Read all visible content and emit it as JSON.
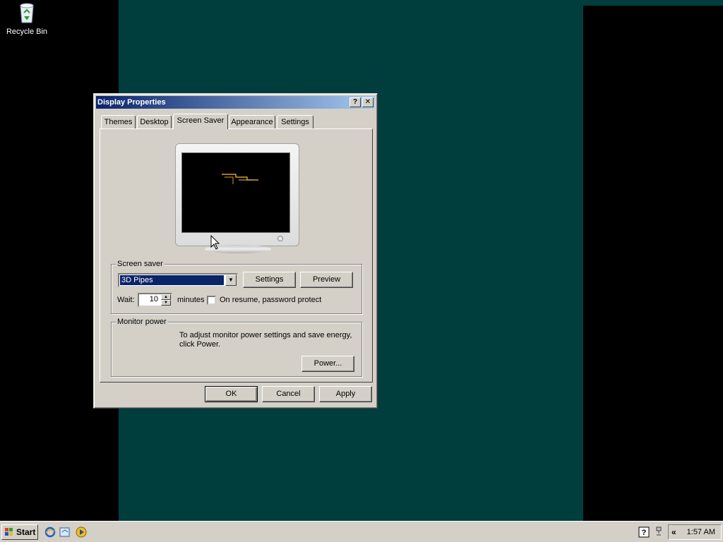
{
  "desktop": {
    "background_color": "#003d3d",
    "icons": [
      {
        "label": "Recycle Bin",
        "icon": "recycle-bin-icon"
      }
    ]
  },
  "dialog": {
    "title": "Display Properties",
    "title_buttons": {
      "help": "?",
      "close": "✕"
    },
    "tabs": [
      {
        "label": "Themes",
        "active": false
      },
      {
        "label": "Desktop",
        "active": false
      },
      {
        "label": "Screen Saver",
        "active": true
      },
      {
        "label": "Appearance",
        "active": false
      },
      {
        "label": "Settings",
        "active": false
      }
    ],
    "screen_saver": {
      "group_title": "Screen saver",
      "selected": "3D Pipes",
      "settings_label": "Settings",
      "preview_label": "Preview",
      "wait_label": "Wait:",
      "wait_value": "10",
      "minutes_label": "minutes",
      "password_label": "On resume, password protect",
      "password_checked": false
    },
    "monitor_power": {
      "group_title": "Monitor power",
      "description_line1": "To adjust monitor power settings and save energy,",
      "description_line2": "click Power.",
      "power_label": "Power..."
    },
    "buttons": {
      "ok": "OK",
      "cancel": "Cancel",
      "apply": "Apply"
    }
  },
  "taskbar": {
    "start_label": "Start",
    "quick_launch": [
      "internet-explorer-icon",
      "outlook-express-icon",
      "media-player-icon"
    ],
    "tray_chevron": "«",
    "clock": "1:57 AM",
    "tray_icons": [
      "help-icon",
      "network-icon"
    ]
  }
}
